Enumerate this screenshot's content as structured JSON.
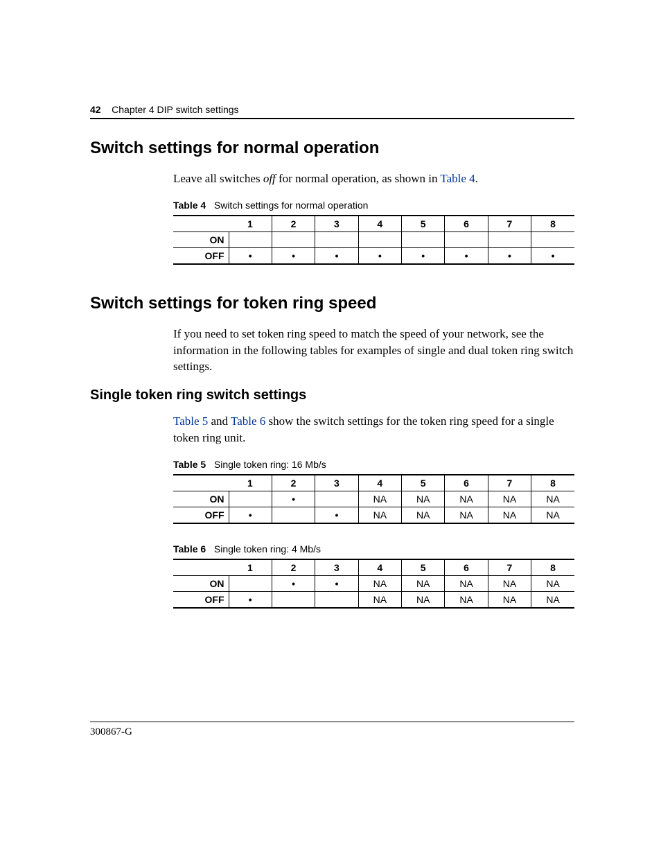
{
  "header": {
    "page_number": "42",
    "chapter_label": "Chapter 4  DIP switch settings"
  },
  "sections": {
    "s1": {
      "heading": "Switch settings for normal operation",
      "para_pre": "Leave all switches ",
      "para_italic": "off",
      "para_mid": " for normal operation, as shown in ",
      "para_link": "Table 4",
      "para_post": "."
    },
    "table4": {
      "caption_label": "Table 4",
      "caption_text": "Switch settings for normal operation"
    },
    "s2": {
      "heading": "Switch settings for token ring speed",
      "para": "If you need to set token ring speed to match the speed of your network, see the information in the following tables for examples of single and dual token ring switch settings."
    },
    "s3": {
      "heading": "Single token ring switch settings",
      "para_link1": "Table 5",
      "para_mid1": " and ",
      "para_link2": "Table 6",
      "para_post": " show the switch settings for the token ring speed for a single token ring unit."
    },
    "table5": {
      "caption_label": "Table 5",
      "caption_text": "Single token ring: 16 Mb/s"
    },
    "table6": {
      "caption_label": "Table 6",
      "caption_text": "Single token ring: 4 Mb/s"
    }
  },
  "columns": [
    "1",
    "2",
    "3",
    "4",
    "5",
    "6",
    "7",
    "8"
  ],
  "row_labels": {
    "on": "ON",
    "off": "OFF"
  },
  "glyph": {
    "dot": "•",
    "na": "NA",
    "blank": ""
  },
  "chart_data": [
    {
      "type": "table",
      "title": "Table 4 Switch settings for normal operation",
      "columns": [
        "1",
        "2",
        "3",
        "4",
        "5",
        "6",
        "7",
        "8"
      ],
      "rows": {
        "ON": [
          "",
          "",
          "",
          "",
          "",
          "",
          "",
          ""
        ],
        "OFF": [
          "•",
          "•",
          "•",
          "•",
          "•",
          "•",
          "•",
          "•"
        ]
      }
    },
    {
      "type": "table",
      "title": "Table 5 Single token ring: 16 Mb/s",
      "columns": [
        "1",
        "2",
        "3",
        "4",
        "5",
        "6",
        "7",
        "8"
      ],
      "rows": {
        "ON": [
          "",
          "•",
          "",
          "NA",
          "NA",
          "NA",
          "NA",
          "NA"
        ],
        "OFF": [
          "•",
          "",
          "•",
          "NA",
          "NA",
          "NA",
          "NA",
          "NA"
        ]
      }
    },
    {
      "type": "table",
      "title": "Table 6 Single token ring: 4 Mb/s",
      "columns": [
        "1",
        "2",
        "3",
        "4",
        "5",
        "6",
        "7",
        "8"
      ],
      "rows": {
        "ON": [
          "",
          "•",
          "•",
          "NA",
          "NA",
          "NA",
          "NA",
          "NA"
        ],
        "OFF": [
          "•",
          "",
          "",
          "NA",
          "NA",
          "NA",
          "NA",
          "NA"
        ]
      }
    }
  ],
  "footer": {
    "doc_id": "300867-G"
  }
}
